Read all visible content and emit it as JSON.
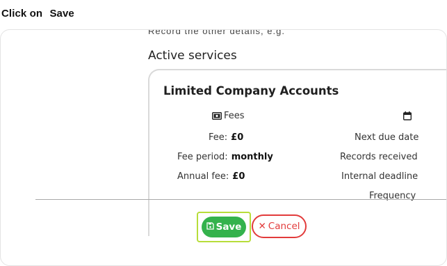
{
  "instruction": {
    "prefix": "Click on",
    "target": "Save"
  },
  "dialog": {
    "clipped_text": "Record the other details, e.g.",
    "section_title": "Active services",
    "service": {
      "title": "Limited Company Accounts",
      "fees_heading": "Fees",
      "fees": [
        {
          "label": "Fee:",
          "value": "£0"
        },
        {
          "label": "Fee period:",
          "value": "monthly"
        },
        {
          "label": "Annual fee:",
          "value": "£0"
        }
      ],
      "schedule_labels": [
        "Next due date",
        "Records received",
        "Internal deadline",
        "Frequency"
      ]
    }
  },
  "actions": {
    "save_label": "Save",
    "cancel_label": "Cancel"
  },
  "colors": {
    "save": "#34b24c",
    "cancel": "#e23b3b",
    "highlight": "#b7dd3a"
  }
}
